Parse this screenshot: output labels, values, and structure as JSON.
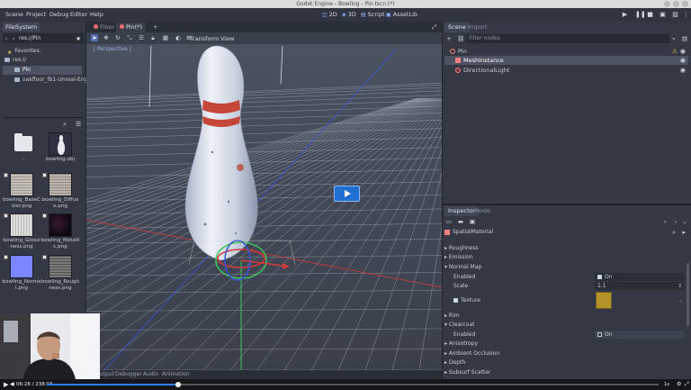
{
  "window": {
    "title": "Godot Engine - Bowling - Pin.tscn (*)"
  },
  "menubar": {
    "menus": [
      "Scene",
      "Project",
      "Debug",
      "Editor",
      "Help"
    ],
    "modes": [
      {
        "label": "2D",
        "icon": "2d-icon"
      },
      {
        "label": "3D",
        "icon": "3d-icon"
      },
      {
        "label": "Script",
        "icon": "script-icon"
      },
      {
        "label": "AssetLib",
        "icon": "assetlib-icon"
      }
    ]
  },
  "filesystem": {
    "tab": "FileSystem",
    "path": "res://Pin",
    "tree": [
      {
        "label": "Favorites:",
        "icon": "star-icon"
      },
      {
        "label": "res://",
        "icon": "folder-icon"
      },
      {
        "label": "Pin",
        "icon": "folder-icon",
        "selected": true
      },
      {
        "label": "oakfloor_fb1-Unreal-Engin",
        "icon": "folder-icon"
      }
    ],
    "files": [
      {
        "name": "..",
        "kind": "folder",
        "color": "#e4e7ec"
      },
      {
        "name": "bowling.obj",
        "kind": "mesh",
        "color": "#2d3140"
      },
      {
        "name": "bowling_BaseColor.png",
        "kind": "image",
        "color": "#b9b4ad"
      },
      {
        "name": "bowling_Diffuse.png",
        "kind": "image",
        "color": "#b0aaa3"
      },
      {
        "name": "bowling_Glossiness.png",
        "kind": "image",
        "color": "#d6d6d6"
      },
      {
        "name": "bowling_Metallic.png",
        "kind": "image",
        "color": "#120a14"
      },
      {
        "name": "bowling_Normal.png",
        "kind": "image",
        "color": "#7c86ff"
      },
      {
        "name": "bowling_Roughness.png",
        "kind": "image",
        "color": "#6d6d6d"
      }
    ]
  },
  "viewport": {
    "tabs": [
      {
        "label": "Floor",
        "active": false
      },
      {
        "label": "Pin(*)",
        "active": true
      }
    ],
    "add_tab": "+",
    "toolbar_menus": [
      "Transform",
      "View"
    ],
    "perspective_label": "[ Perspective ]",
    "bottom_tabs": [
      "Output",
      "Debugger",
      "Audio",
      "Animation"
    ]
  },
  "scene": {
    "tabs": [
      "Scene",
      "Import"
    ],
    "filter_placeholder": "Filter nodes",
    "nodes": [
      {
        "label": "Pin",
        "icon": "spatial-icon",
        "color": "#fc7f7f",
        "warning": true
      },
      {
        "label": "MeshInstance",
        "icon": "meshinstance-icon",
        "color": "#fc7f7f",
        "selected": true
      },
      {
        "label": "DirectionalLight",
        "icon": "light-icon",
        "color": "#fc7f7f"
      }
    ]
  },
  "inspector": {
    "tabs": [
      "Inspector",
      "Node"
    ],
    "resource": "SpatialMaterial",
    "rows": [
      {
        "type": "section",
        "label": "Roughness"
      },
      {
        "type": "section",
        "label": "Emission"
      },
      {
        "type": "section-open",
        "label": "Normal Map"
      },
      {
        "type": "prop",
        "label": "Enabled",
        "value": "On",
        "checked": true
      },
      {
        "type": "prop",
        "label": "Scale",
        "value": "1.1"
      },
      {
        "type": "texture",
        "label": "Texture",
        "color": "#b3922a"
      },
      {
        "type": "section",
        "label": "Rim"
      },
      {
        "type": "section-open",
        "label": "Clearcoat"
      },
      {
        "type": "prop",
        "label": "Enabled",
        "value": "On",
        "checked": false
      },
      {
        "type": "section",
        "label": "Anisotropy"
      },
      {
        "type": "section",
        "label": "Ambient Occlusion"
      },
      {
        "type": "section",
        "label": "Depth"
      },
      {
        "type": "section",
        "label": "Subsurf Scatter"
      }
    ]
  },
  "player": {
    "time": "06:28 / 238:03",
    "progress": 0.215
  },
  "colors": {
    "accent": "#546db0",
    "play": "#1f6fd1",
    "grid": "#d0d6e2",
    "axis_red": "#d23b3b",
    "axis_blue": "#3a56d6",
    "axis_green": "#3fc35c"
  }
}
